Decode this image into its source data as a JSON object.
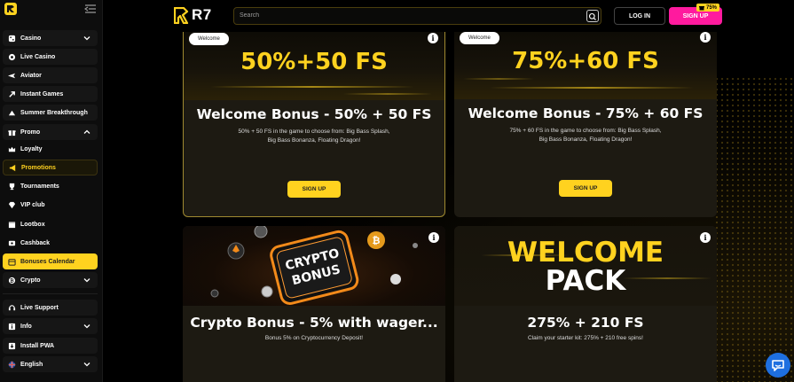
{
  "sidebar": {
    "items": [
      {
        "label": "Casino",
        "icon": "casino-icon"
      },
      {
        "label": "Live Casino",
        "icon": "live-casino-icon"
      },
      {
        "label": "Aviator",
        "icon": "plane-icon"
      },
      {
        "label": "Instant Games",
        "icon": "rocket-icon"
      },
      {
        "label": "Summer Breakthrough",
        "icon": "sun-icon"
      },
      {
        "label": "Promo",
        "icon": "gift-icon"
      },
      {
        "label": "Loyalty",
        "icon": "crown-icon"
      },
      {
        "label": "Promotions",
        "icon": "megaphone-icon"
      },
      {
        "label": "Tournaments",
        "icon": "trophy-icon"
      },
      {
        "label": "VIP club",
        "icon": "diamond-icon"
      },
      {
        "label": "Lootbox",
        "icon": "box-icon"
      },
      {
        "label": "Cashback",
        "icon": "cashback-icon"
      },
      {
        "label": "Bonuses Calendar",
        "icon": "calendar-icon"
      },
      {
        "label": "Crypto",
        "icon": "bitcoin-icon"
      },
      {
        "label": "Live Support",
        "icon": "headset-icon"
      },
      {
        "label": "Info",
        "icon": "info-icon"
      },
      {
        "label": "Install PWA",
        "icon": "download-icon"
      },
      {
        "label": "English",
        "icon": "uk-flag-icon"
      }
    ]
  },
  "header": {
    "logo_text": "R7",
    "search_placeholder": "Search",
    "login_label": "LOG IN",
    "signup_label": "SIGN UP",
    "signup_badge": "75%"
  },
  "cards": [
    {
      "tag": "Welcome",
      "promo": "50%+50 FS",
      "title": "Welcome Bonus - 50% + 50 FS",
      "desc": "50% + 50 FS in the game to choose from: Big Bass Splash, Big Bass Bonanza, Floating Dragon!",
      "button": "SIGN UP"
    },
    {
      "tag": "Welcome",
      "promo": "75%+60 FS",
      "title": "Welcome Bonus - 75% + 60 FS",
      "desc": "75% + 60 FS in the game to choose from: Big Bass Splash, Big Bass Bonanza, Floating Dragon!",
      "button": "SIGN UP"
    },
    {
      "promo_line1": "CRYPTO",
      "promo_line2": "BONUS",
      "title": "Crypto Bonus - 5% with wager...",
      "desc": "Bonus 5% on Cryptocurrency Deposit!"
    },
    {
      "promo_line1": "WELCOME",
      "promo_line2": "PACK",
      "title": "275% + 210 FS",
      "desc": "Claim your starter kit: 275% + 210 free spins!"
    }
  ],
  "colors": {
    "accent": "#ffd21f",
    "signup": "#ff1a9e",
    "chat": "#1e6fe0"
  }
}
